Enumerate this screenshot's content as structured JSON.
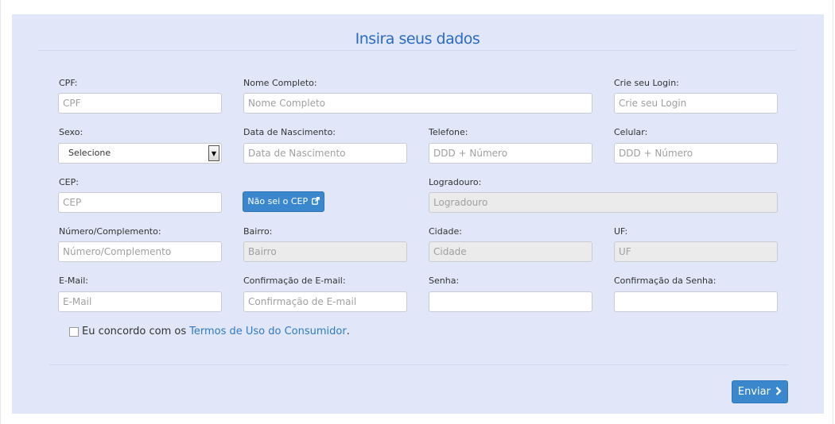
{
  "form": {
    "title": "Insira seus dados",
    "fields": {
      "cpf": {
        "label": "CPF:",
        "placeholder": "CPF"
      },
      "nome": {
        "label": "Nome Completo:",
        "placeholder": "Nome Completo"
      },
      "login": {
        "label": "Crie seu Login:",
        "placeholder": "Crie seu Login"
      },
      "sexo": {
        "label": "Sexo:",
        "selected": "Selecione"
      },
      "nascimento": {
        "label": "Data de Nascimento:",
        "placeholder": "Data de Nascimento"
      },
      "telefone": {
        "label": "Telefone:",
        "placeholder": "DDD + Número"
      },
      "celular": {
        "label": "Celular:",
        "placeholder": "DDD + Número"
      },
      "cep": {
        "label": "CEP:",
        "placeholder": "CEP"
      },
      "logradouro": {
        "label": "Logradouro:",
        "placeholder": "Logradouro"
      },
      "numero": {
        "label": "Número/Complemento:",
        "placeholder": "Número/Complemento"
      },
      "bairro": {
        "label": "Bairro:",
        "placeholder": "Bairro"
      },
      "cidade": {
        "label": "Cidade:",
        "placeholder": "Cidade"
      },
      "uf": {
        "label": "UF:",
        "placeholder": "UF"
      },
      "email": {
        "label": "E-Mail:",
        "placeholder": "E-Mail"
      },
      "email_conf": {
        "label": "Confirmação de E-mail:",
        "placeholder": "Confirmação de E-mail"
      },
      "senha": {
        "label": "Senha:",
        "placeholder": ""
      },
      "senha_conf": {
        "label": "Confirmação da Senha:",
        "placeholder": ""
      }
    },
    "cep_button": {
      "label": "Não sei o CEP",
      "icon": "external-link-icon"
    },
    "agreement": {
      "text": "Eu concordo com os",
      "link": "Termos de Uso do Consumidor",
      "suffix": "."
    },
    "submit": {
      "label": "Enviar",
      "icon": "chevron-right-icon"
    },
    "colors": {
      "accent": "#3a87cd",
      "title": "#2a6bc8",
      "panel": "#e1e7f8"
    }
  }
}
